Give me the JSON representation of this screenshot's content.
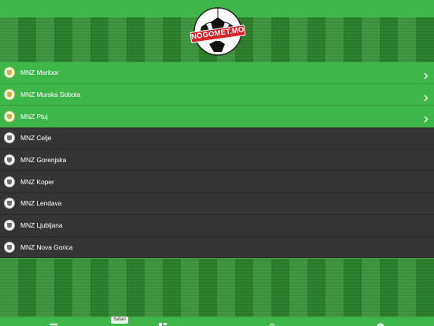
{
  "app": {
    "logo_text": "NOGOMET.MOBI",
    "brand_green": "#3fb64a",
    "dark_row": "#353535",
    "accent_red": "#d9232a"
  },
  "associations": [
    {
      "label": "MNZ Maribor",
      "style": "green",
      "has_chevron": true,
      "crest_icon": "crest-maribor-icon"
    },
    {
      "label": "MNZ Murska Sobota",
      "style": "green",
      "has_chevron": true,
      "crest_icon": "crest-murska-sobota-icon"
    },
    {
      "label": "MNZ Ptuj",
      "style": "green",
      "has_chevron": true,
      "crest_icon": "crest-ptuj-icon"
    },
    {
      "label": "MNZ Celje",
      "style": "dark",
      "has_chevron": false,
      "crest_icon": "crest-celje-icon"
    },
    {
      "label": "MNZ Gorenjska",
      "style": "dark",
      "has_chevron": false,
      "crest_icon": "crest-gorenjska-icon"
    },
    {
      "label": "MNZ Koper",
      "style": "dark",
      "has_chevron": false,
      "crest_icon": "crest-koper-icon"
    },
    {
      "label": "MNZ Lendava",
      "style": "dark",
      "has_chevron": false,
      "crest_icon": "crest-lendava-icon"
    },
    {
      "label": "MNZ Ljubljana",
      "style": "dark",
      "has_chevron": false,
      "crest_icon": "crest-ljubljana-icon"
    },
    {
      "label": "MNZ Nova Gorica",
      "style": "dark",
      "has_chevron": false,
      "crest_icon": "crest-nova-gorica-icon"
    }
  ],
  "tabbar": {
    "tooltip": "Safari",
    "tabs": [
      {
        "name": "list-icon"
      },
      {
        "name": "grid-icon"
      },
      {
        "name": "gear-icon"
      },
      {
        "name": "info-icon"
      }
    ]
  }
}
